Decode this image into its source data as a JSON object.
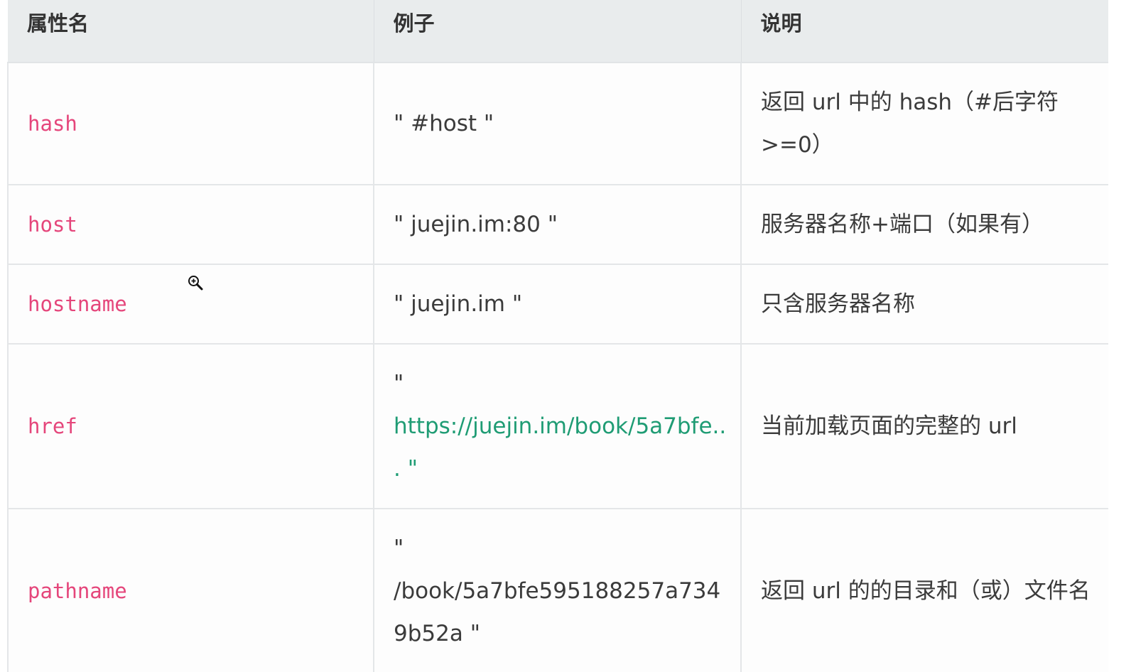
{
  "table": {
    "headers": [
      "属性名",
      "例子",
      "说明"
    ],
    "rows": [
      {
        "name": "hash",
        "example_lines": [
          "\" #host \""
        ],
        "desc": "返回 url 中的 hash（#后字符 >=0）"
      },
      {
        "name": "host",
        "example_lines": [
          "\" juejin.im:80 \""
        ],
        "desc": "服务器名称+端口（如果有）"
      },
      {
        "name": "hostname",
        "example_lines": [
          "\" juejin.im \""
        ],
        "desc": "只含服务器名称"
      },
      {
        "name": "href",
        "example_lines": [
          "\"",
          "https://juejin.im/book/5a7bfe..",
          ". \""
        ],
        "desc": "当前加载页面的完整的 url"
      },
      {
        "name": "pathname",
        "example_lines": [
          "\"",
          "/book/5a7bfe595188257a734",
          "9b52a \""
        ],
        "desc": "返回 url 的的目录和（或）文件名"
      }
    ]
  },
  "cursor": {
    "icon": "zoom-in-cursor-icon"
  },
  "colors": {
    "header_bg": "#e9eced",
    "code_text": "#e5467b",
    "link_text": "#1f9c74",
    "border": "#e4e6e8"
  }
}
